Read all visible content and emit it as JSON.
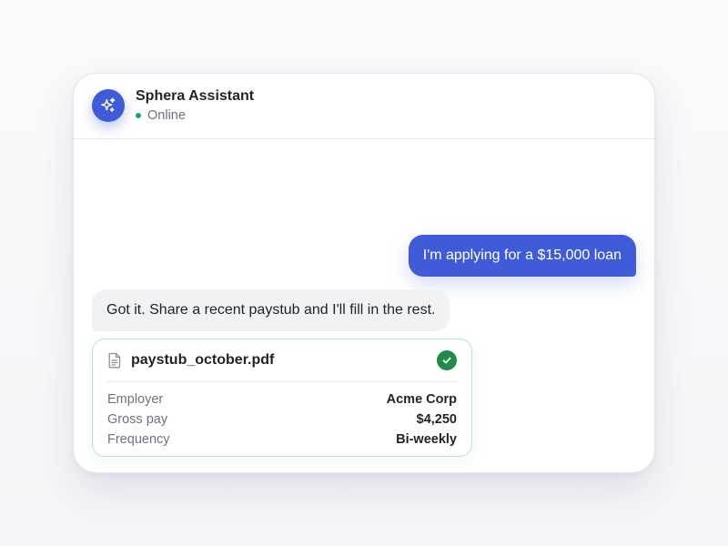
{
  "header": {
    "assistant_name": "Sphera Assistant",
    "status": "Online",
    "avatar_icon": "sparkles-icon",
    "status_color": "#22a06b"
  },
  "messages": {
    "user_text": "I'm applying for a $15,000 loan",
    "assistant_text": "Got it. Share a recent paystub and I'll fill in the rest."
  },
  "attachment": {
    "file_icon": "document-icon",
    "file_name": "paystub_october.pdf",
    "status_icon": "check-circle-icon",
    "details": [
      {
        "label": "Employer",
        "value": "Acme Corp"
      },
      {
        "label": "Gross pay",
        "value": "$4,250"
      },
      {
        "label": "Frequency",
        "value": "Bi-weekly"
      }
    ]
  },
  "colors": {
    "accent": "#3f5bd8",
    "success": "#1f8a4c",
    "card_border": "#b9e6c9"
  }
}
